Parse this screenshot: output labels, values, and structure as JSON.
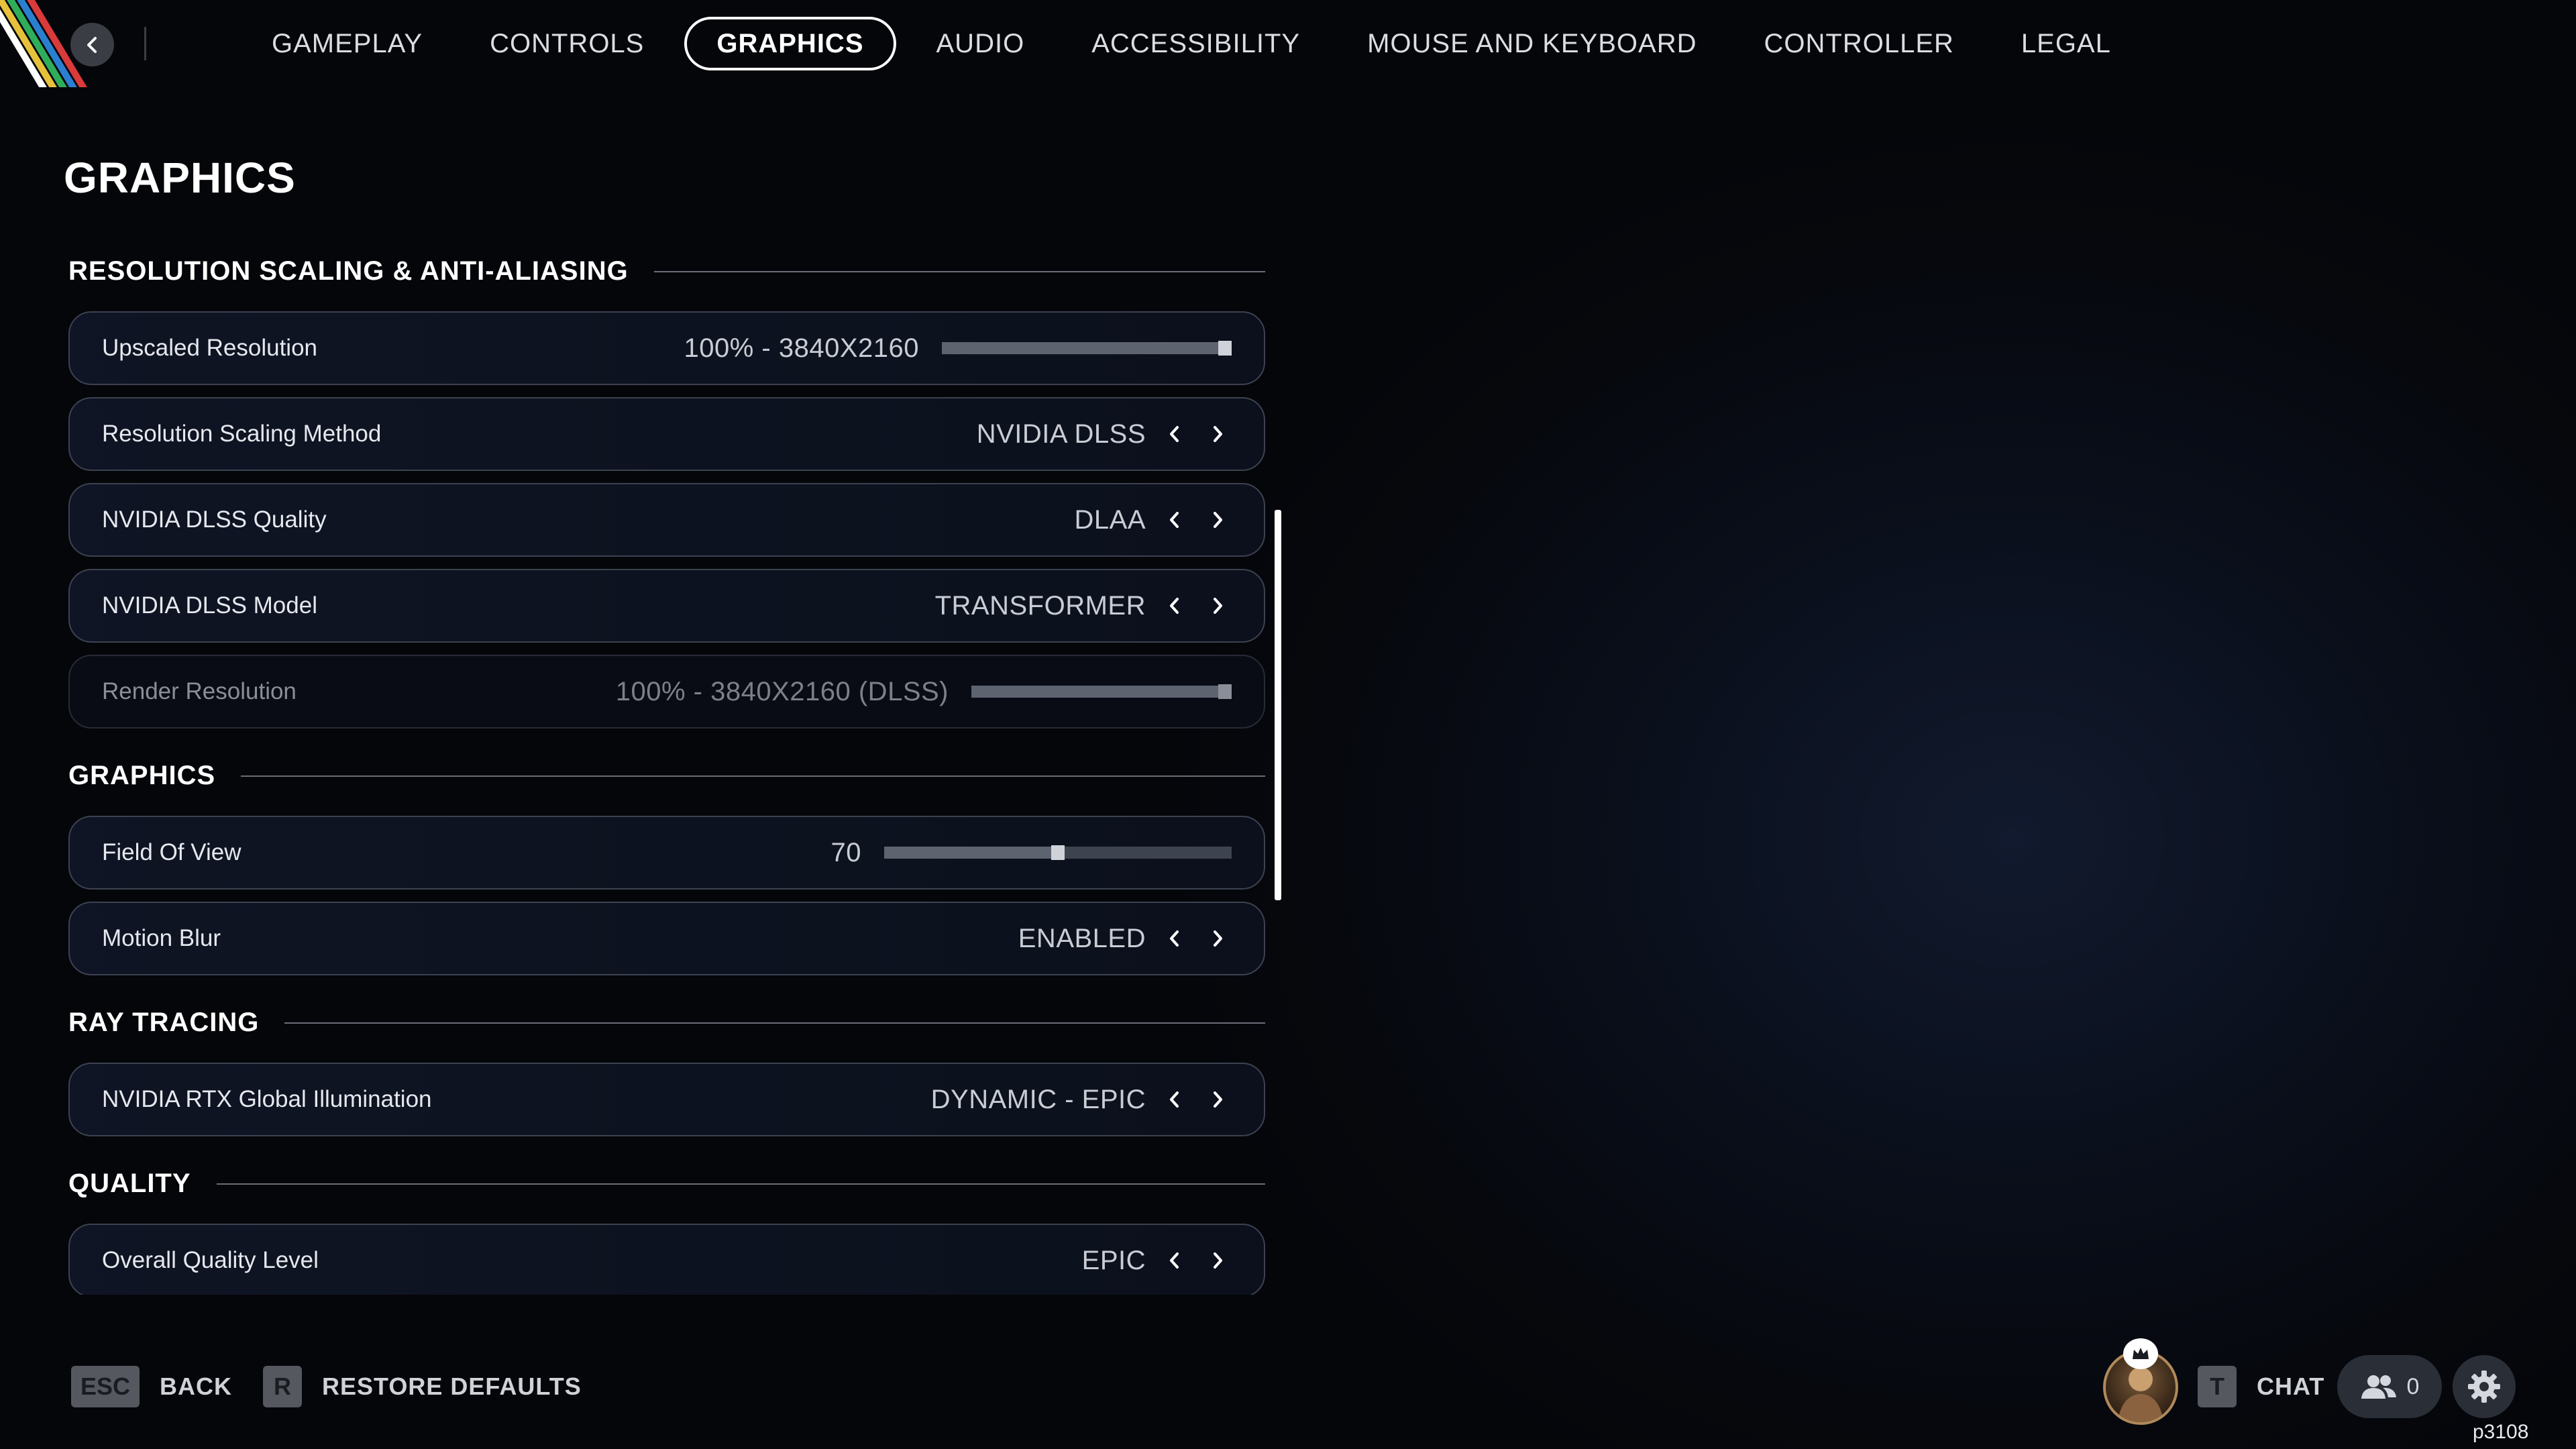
{
  "nav": {
    "tabs": [
      {
        "label": "GAMEPLAY"
      },
      {
        "label": "CONTROLS"
      },
      {
        "label": "GRAPHICS",
        "active": true
      },
      {
        "label": "AUDIO"
      },
      {
        "label": "ACCESSIBILITY"
      },
      {
        "label": "MOUSE AND KEYBOARD"
      },
      {
        "label": "CONTROLLER"
      },
      {
        "label": "LEGAL"
      }
    ]
  },
  "page_title": "GRAPHICS",
  "sections": {
    "resolution": {
      "title": "RESOLUTION SCALING & ANTI-ALIASING",
      "rows": [
        {
          "label": "Upscaled Resolution",
          "value": "100% - 3840X2160",
          "control": "slider",
          "level": 1.0
        },
        {
          "label": "Resolution Scaling Method",
          "value": "NVIDIA DLSS",
          "control": "selector"
        },
        {
          "label": "NVIDIA DLSS Quality",
          "value": "DLAA",
          "control": "selector"
        },
        {
          "label": "NVIDIA DLSS Model",
          "value": "TRANSFORMER",
          "control": "selector"
        },
        {
          "label": "Render Resolution",
          "value": "100% - 3840X2160 (DLSS)",
          "control": "slider",
          "level": 1.0,
          "disabled": true
        }
      ]
    },
    "graphics": {
      "title": "GRAPHICS",
      "rows": [
        {
          "label": "Field Of View",
          "value": "70",
          "control": "slider",
          "level": 0.5
        },
        {
          "label": "Motion Blur",
          "value": "ENABLED",
          "control": "selector"
        }
      ]
    },
    "ray_tracing": {
      "title": "RAY TRACING",
      "rows": [
        {
          "label": "NVIDIA RTX Global Illumination",
          "value": "DYNAMIC - EPIC",
          "control": "selector"
        }
      ]
    },
    "quality": {
      "title": "QUALITY",
      "rows": [
        {
          "label": "Overall Quality Level",
          "value": "EPIC",
          "control": "selector"
        }
      ]
    }
  },
  "footer": {
    "back_key": "ESC",
    "back_label": "BACK",
    "restore_key": "R",
    "restore_label": "RESTORE DEFAULTS",
    "chat_key": "T",
    "chat_label": "CHAT",
    "friends_count": "0",
    "build": "p3108"
  },
  "icons": {
    "back": "chevron-left-icon",
    "prev": "chevron-left-icon",
    "next": "chevron-right-icon",
    "friends": "friends-icon",
    "settings": "gear-icon",
    "crown": "crown-icon"
  }
}
